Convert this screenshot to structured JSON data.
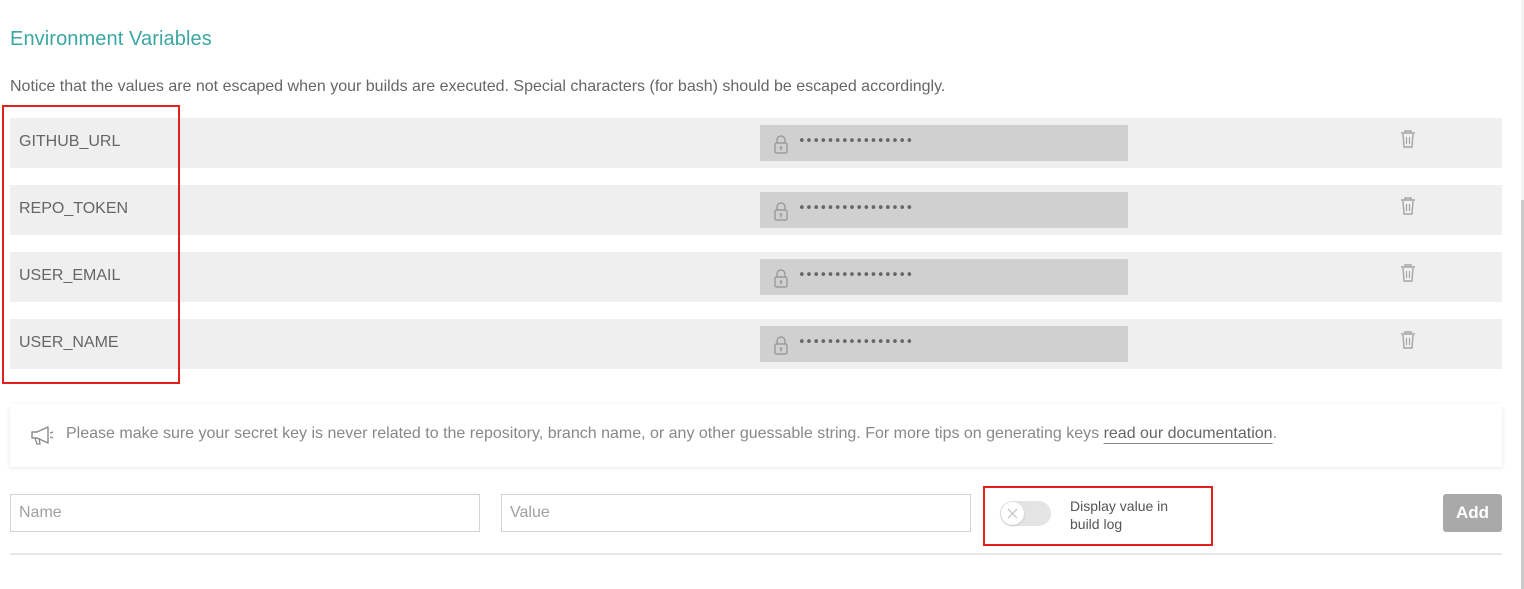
{
  "section": {
    "title": "Environment Variables",
    "notice": "Notice that the values are not escaped when your builds are executed. Special characters (for bash) should be escaped accordingly."
  },
  "variables": [
    {
      "name": "GITHUB_URL",
      "value_masked": "••••••••••••••••"
    },
    {
      "name": "REPO_TOKEN",
      "value_masked": "••••••••••••••••"
    },
    {
      "name": "USER_EMAIL",
      "value_masked": "••••••••••••••••"
    },
    {
      "name": "USER_NAME",
      "value_masked": "••••••••••••••••"
    }
  ],
  "icons": {
    "lock": "lock-icon",
    "delete": "trash-icon",
    "tip": "megaphone-icon",
    "toggle_off": "close-icon"
  },
  "tip": {
    "text": "Please make sure your secret key is never related to the repository, branch name, or any other guessable string. For more tips on generating keys ",
    "link_text": "read our documentation",
    "suffix": "."
  },
  "add_form": {
    "name_placeholder": "Name",
    "value_placeholder": "Value",
    "display_toggle_label": "Display value in build log",
    "display_toggle_on": false,
    "add_button_label": "Add"
  },
  "colors": {
    "title": "#3aa7a3",
    "row_background": "#efefef",
    "value_background": "#d0d0d0",
    "highlight_border": "#e3201b",
    "add_button": "#a9a9a9"
  }
}
